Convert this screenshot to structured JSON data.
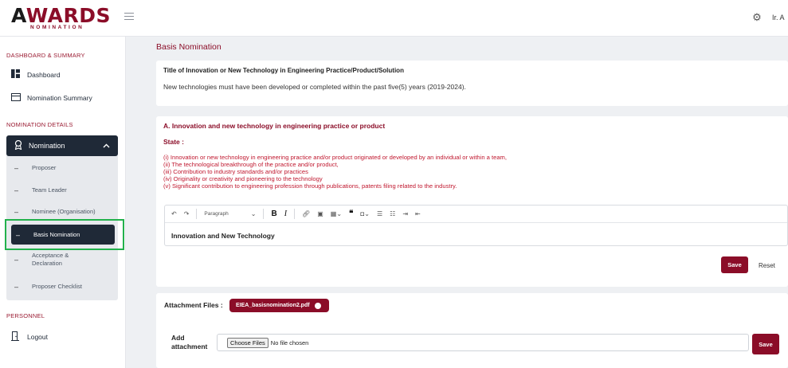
{
  "brand": {
    "logo_main": "AWARDS",
    "logo_sub": "NOMINATION",
    "accent_color": "#8b0d28",
    "dark_color": "#1f2937"
  },
  "header": {
    "settings_icon": "gear-icon",
    "user_name": "Ir. A"
  },
  "sidebar": {
    "section_dashboard": "DASHBOARD & SUMMARY",
    "dashboard_label": "Dashboard",
    "summary_label": "Nomination Summary",
    "section_details": "NOMINATION DETAILS",
    "nomination_label": "Nomination",
    "sub_items": [
      {
        "label": "Proposer"
      },
      {
        "label": "Team Leader"
      },
      {
        "label": "Nominee (Organisation)"
      },
      {
        "label": "Basis Nomination"
      },
      {
        "label": "Acceptance & Declaration"
      },
      {
        "label": "Proposer Checklist"
      }
    ],
    "section_personnel": "PERSONNEL",
    "logout_label": "Logout"
  },
  "main": {
    "page_title": "Basis Nomination",
    "title_card": {
      "heading": "Title of Innovation or New Technology in Engineering Practice/Product/Solution",
      "text": "New technologies must have been developed or completed within the past five(5) years (2019-2024)."
    },
    "section_a": {
      "heading": "A. Innovation and new technology in engineering practice or product",
      "state_label": "State :",
      "criteria": [
        "(i) Innovation or new technology in engineering practice and/or product originated or developed by an individual or within a team,",
        "(ii) The technological breakthrough of the practice and/or product,",
        "(iii) Contribution to industry standards and/or practices",
        "(iv) Originality or creativity and pioneering to the technology",
        "(v) Significant contribution to engineering profession through publications, patents filing related to the industry."
      ],
      "toolbar_block_style": "Paragraph",
      "editor_content": "Innovation and New Technology",
      "save_label": "Save",
      "reset_label": "Reset"
    },
    "attachments": {
      "label": "Attachment Files :",
      "file_name": "EIEA_basisnomination2.pdf",
      "add_label": "Add attachment",
      "choose_label": "Choose Files",
      "no_file_text": "No file chosen",
      "save_label": "Save"
    }
  }
}
